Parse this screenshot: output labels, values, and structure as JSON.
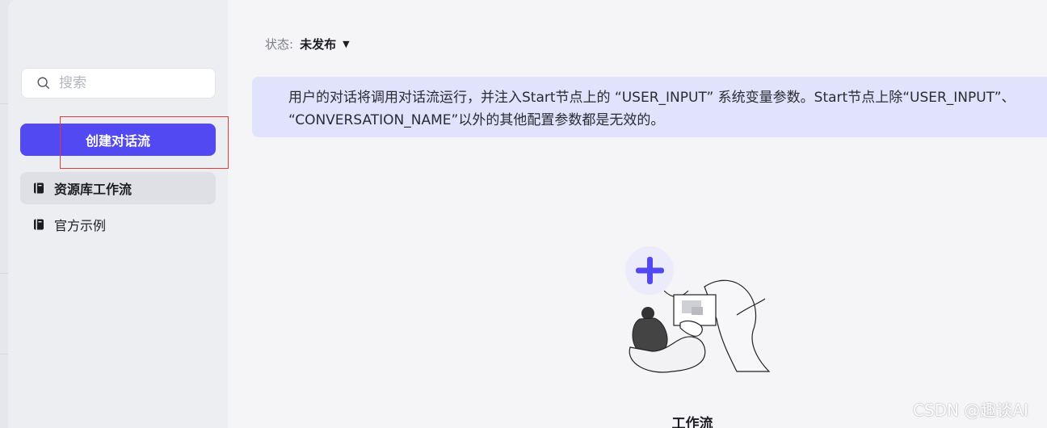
{
  "sidebar": {
    "search_placeholder": "搜索",
    "create_button": "创建对话流",
    "items": [
      {
        "label": "资源库工作流",
        "icon": "book-icon",
        "active": true
      },
      {
        "label": "官方示例",
        "icon": "book-icon",
        "active": false
      }
    ]
  },
  "main": {
    "status_label": "状态:",
    "status_value": "未发布",
    "notice_line1": "用户的对话将调用对话流运行，并注入Start节点上的 “USER_INPUT” 系统变量参数。Start节点上除“USER_INPUT”、",
    "notice_line2": "“CONVERSATION_NAME”以外的其他配置参数都是无效的。",
    "empty_title": "工作流"
  },
  "watermark": "CSDN @趣谈AI",
  "colors": {
    "accent": "#5249f2",
    "notice_bg": "#e1e2fb",
    "highlight_border": "#e03a3a"
  }
}
